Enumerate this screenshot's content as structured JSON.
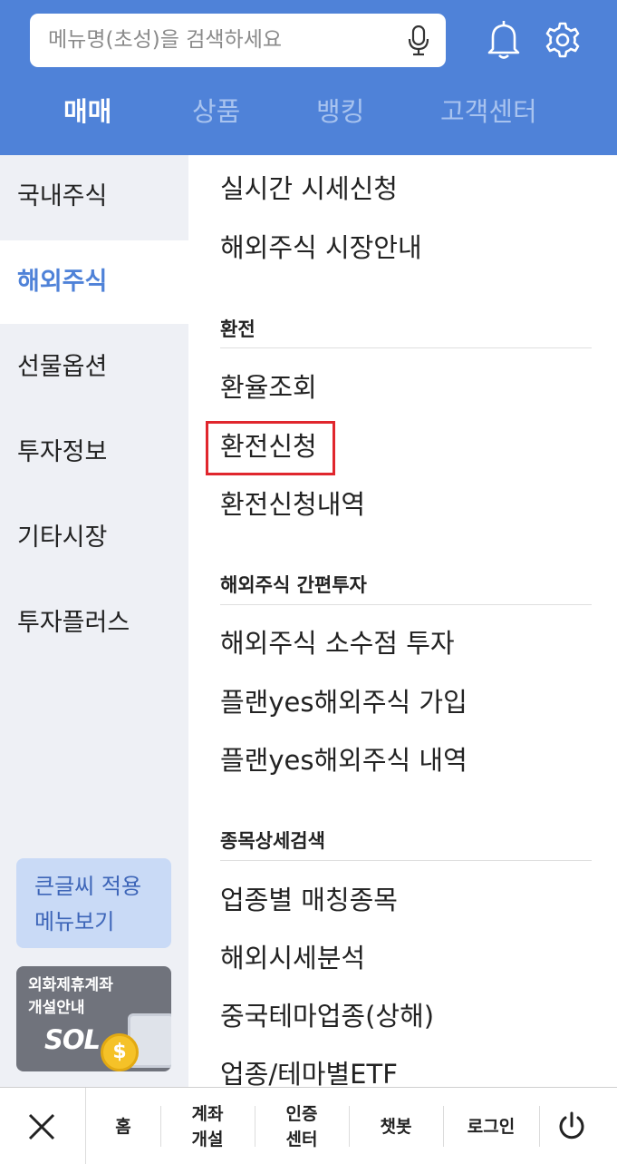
{
  "search": {
    "placeholder": "메뉴명(초성)을 검색하세요"
  },
  "top_tabs": [
    "매매",
    "상품",
    "뱅킹",
    "고객센터"
  ],
  "sidebar": {
    "items": [
      "국내주식",
      "해외주식",
      "선물옵션",
      "투자정보",
      "기타시장",
      "투자플러스"
    ],
    "active": "해외주식",
    "big_font_button": [
      "큰글씨 적용",
      "메뉴보기"
    ],
    "banner": {
      "lines": [
        "외화제휴계좌",
        "개설안내"
      ],
      "logo": "SOL",
      "coin": "$"
    }
  },
  "content": {
    "links_top": [
      "실시간 시세신청",
      "해외주식 시장안내"
    ],
    "sections": [
      {
        "title": "환전",
        "links": [
          "환율조회",
          "환전신청",
          "환전신청내역"
        ]
      },
      {
        "title": "해외주식 간편투자",
        "links": [
          "해외주식 소수점 투자",
          "플랜yes해외주식 가입",
          "플랜yes해외주식 내역"
        ]
      },
      {
        "title": "종목상세검색",
        "links": [
          "업종별 매칭종목",
          "해외시세분석",
          "중국테마업종(상해)",
          "업종/테마별ETF"
        ]
      }
    ],
    "highlighted": "환전신청"
  },
  "bottom_bar": {
    "items": [
      {
        "lines": [
          "홈"
        ]
      },
      {
        "lines": [
          "계좌",
          "개설"
        ]
      },
      {
        "lines": [
          "인증",
          "센터"
        ]
      },
      {
        "lines": [
          "챗봇"
        ]
      },
      {
        "lines": [
          "로그인"
        ]
      }
    ]
  },
  "colors": {
    "header": "#4f82d8",
    "sidebar_bg": "#eef0f5",
    "highlight_border": "#e0262d",
    "active_text": "#4f82d8"
  }
}
